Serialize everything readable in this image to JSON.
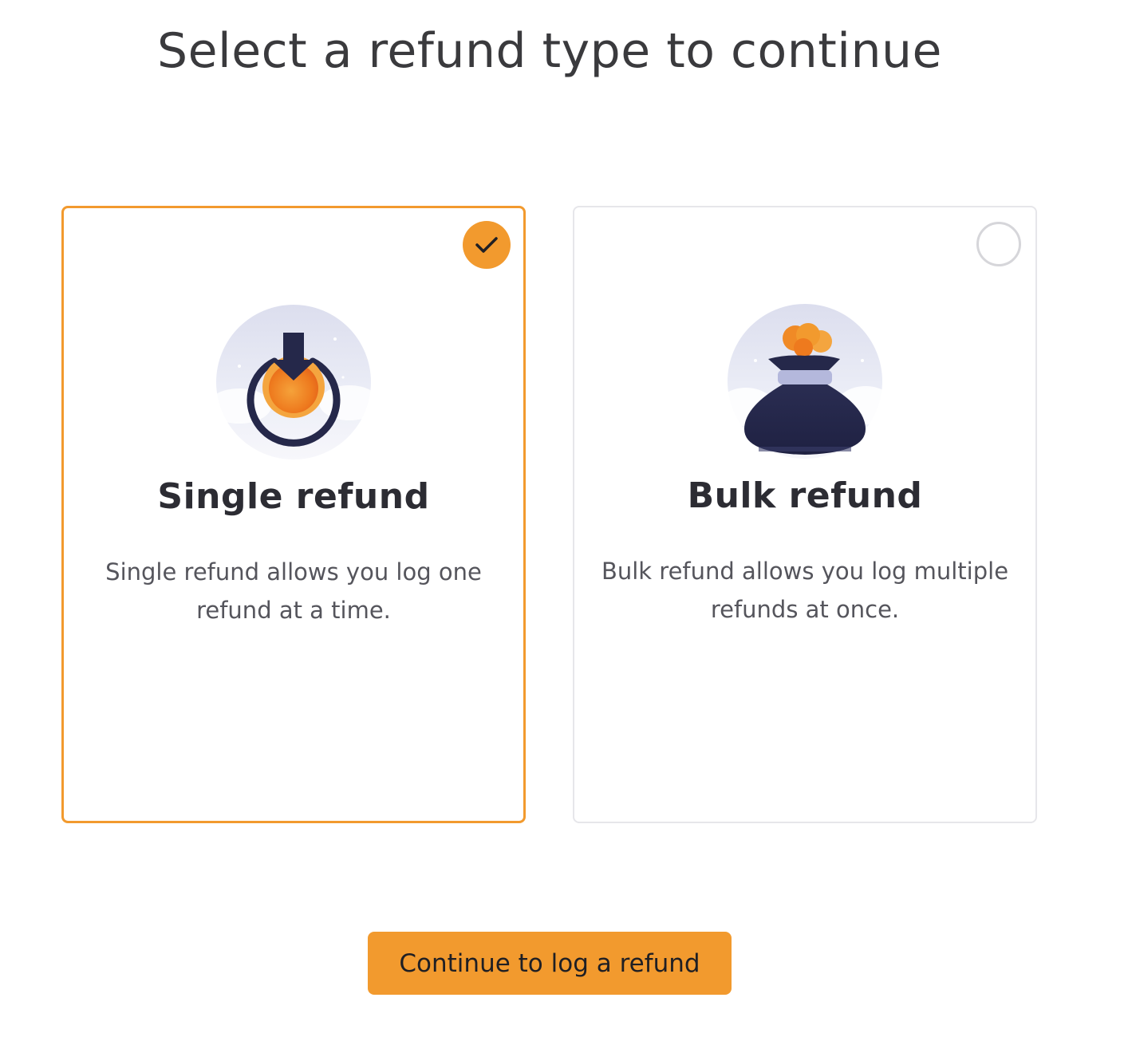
{
  "page": {
    "title": "Select a refund type to continue"
  },
  "options": [
    {
      "title": "Single refund",
      "description": "Single refund allows you log one refund at a time.",
      "selected": true,
      "icon": "single-refund-coin-icon"
    },
    {
      "title": "Bulk refund",
      "description": "Bulk refund allows you log multiple refunds at once.",
      "selected": false,
      "icon": "money-bag-icon"
    }
  ],
  "actions": {
    "continue_label": "Continue to log a refund"
  },
  "colors": {
    "accent": "#f29a2e",
    "navy": "#25284a",
    "illustration_bg": "#e3e4f1"
  }
}
